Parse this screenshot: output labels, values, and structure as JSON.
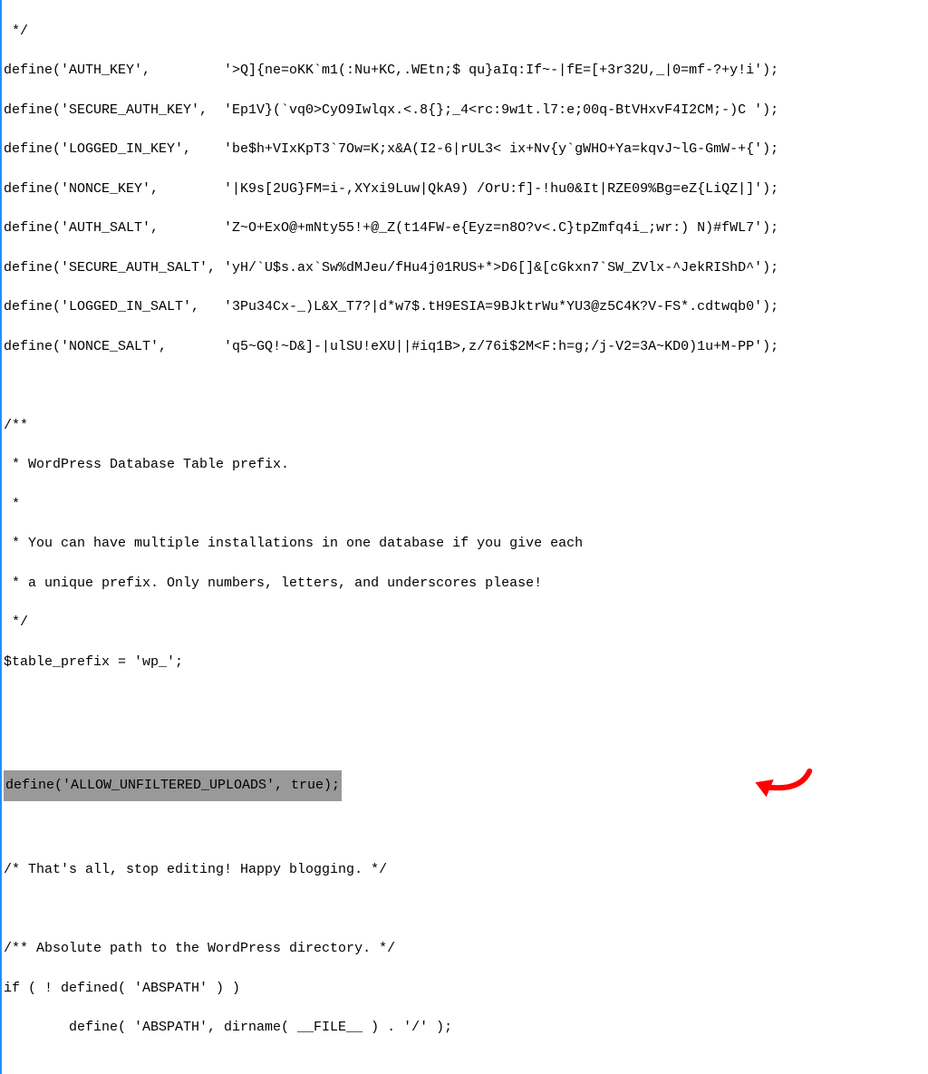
{
  "lines": {
    "close_comment": " */",
    "auth_key": "define('AUTH_KEY',         '>Q]{ne=oKK`m1(:Nu+KC,.WEtn;$ qu}aIq:If~-|fE=[+3r32U,_|0=mf-?+y!i');",
    "secure_auth_key": "define('SECURE_AUTH_KEY',  'Ep1V}(`vq0>CyO9Iwlqx.<.8{};_4<rc:9w1t.l7:e;00q-BtVHxvF4I2CM;-)C ');",
    "logged_in_key": "define('LOGGED_IN_KEY',    'be$h+VIxKpT3`7Ow=K;x&A(I2-6|rUL3< ix+Nv{y`gWHO+Ya=kqvJ~lG-GmW-+{');",
    "nonce_key": "define('NONCE_KEY',        '|K9s[2UG}FM=i-,XYxi9Luw|QkA9) /OrU:f]-!hu0&It|RZE09%Bg=eZ{LiQZ|]');",
    "auth_salt": "define('AUTH_SALT',        'Z~O+ExO@+mNty55!+@_Z(t14FW-e{Eyz=n8O?v<.C}tpZmfq4i_;wr:) N)#fWL7');",
    "secure_auth_salt": "define('SECURE_AUTH_SALT', 'yH/`U$s.ax`Sw%dMJeu/fHu4j01RUS+*>D6[]&[cGkxn7`SW_ZVlx-^JekRIShD^');",
    "logged_in_salt": "define('LOGGED_IN_SALT',   '3Pu34Cx-_)L&X_T7?|d*w7$.tH9ESIA=9BJktrWu*YU3@z5C4K?V-FS*.cdtwqb0');",
    "nonce_salt": "define('NONCE_SALT',       'q5~GQ!~D&]-|ulSU!eXU||#iq1B>,z/76i$2M<F:h=g;/j-V2=3A~KD0)1u+M-PP');",
    "comment_open": "/**",
    "comment_line1": " * WordPress Database Table prefix.",
    "comment_star": " *",
    "comment_line2": " * You can have multiple installations in one database if you give each",
    "comment_line3": " * a unique prefix. Only numbers, letters, and underscores please!",
    "comment_close": " */",
    "table_prefix": "$table_prefix = 'wp_';",
    "highlighted": "define('ALLOW_UNFILTERED_UPLOADS', true);",
    "stop_comment": "/* That's all, stop editing! Happy blogging. */",
    "abspath_comment": "/** Absolute path to the WordPress directory. */",
    "if_defined": "if ( ! defined( 'ABSPATH' ) )",
    "define_abspath": "        define( 'ABSPATH', dirname( __FILE__ ) . '/' );"
  }
}
